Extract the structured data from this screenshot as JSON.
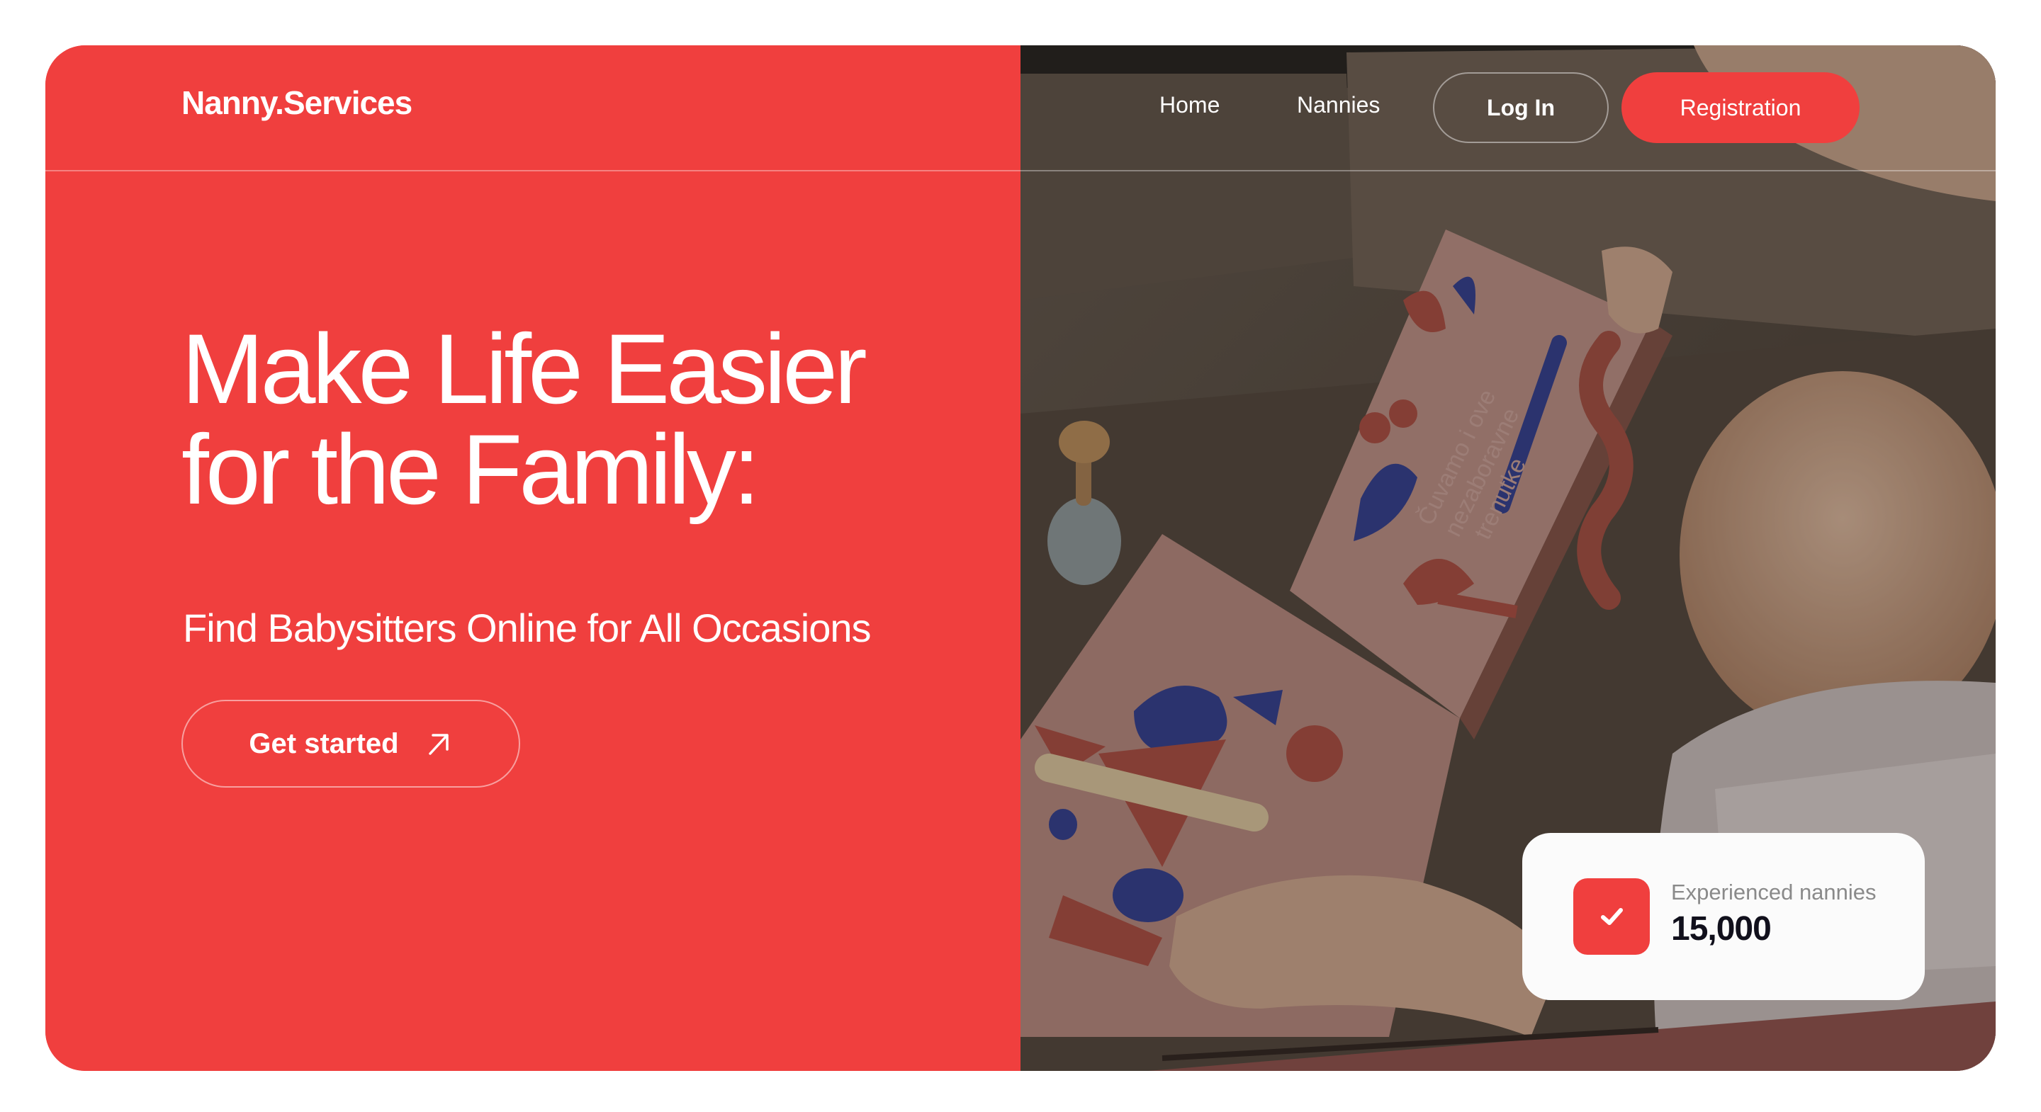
{
  "brand": {
    "logo": "Nanny.Services",
    "accent_color": "#f03f3e",
    "text_color": "#ffffff"
  },
  "nav": {
    "items": [
      {
        "label": "Home"
      },
      {
        "label": "Nannies"
      }
    ],
    "login_label": "Log In",
    "register_label": "Registration"
  },
  "hero": {
    "headline_line1": "Make Life Easier",
    "headline_line2": "for the Family:",
    "subheadline": "Find Babysitters Online for All Occasions",
    "cta_label": "Get started",
    "cta_icon": "arrow-up-right-icon"
  },
  "stat_card": {
    "icon": "check-icon",
    "label": "Experienced nannies",
    "value": "15,000"
  },
  "hero_image": {
    "book_text_line1": "Čuvamo i ove",
    "book_text_line2": "nezaboravne",
    "book_text_line3": "trenutke"
  }
}
